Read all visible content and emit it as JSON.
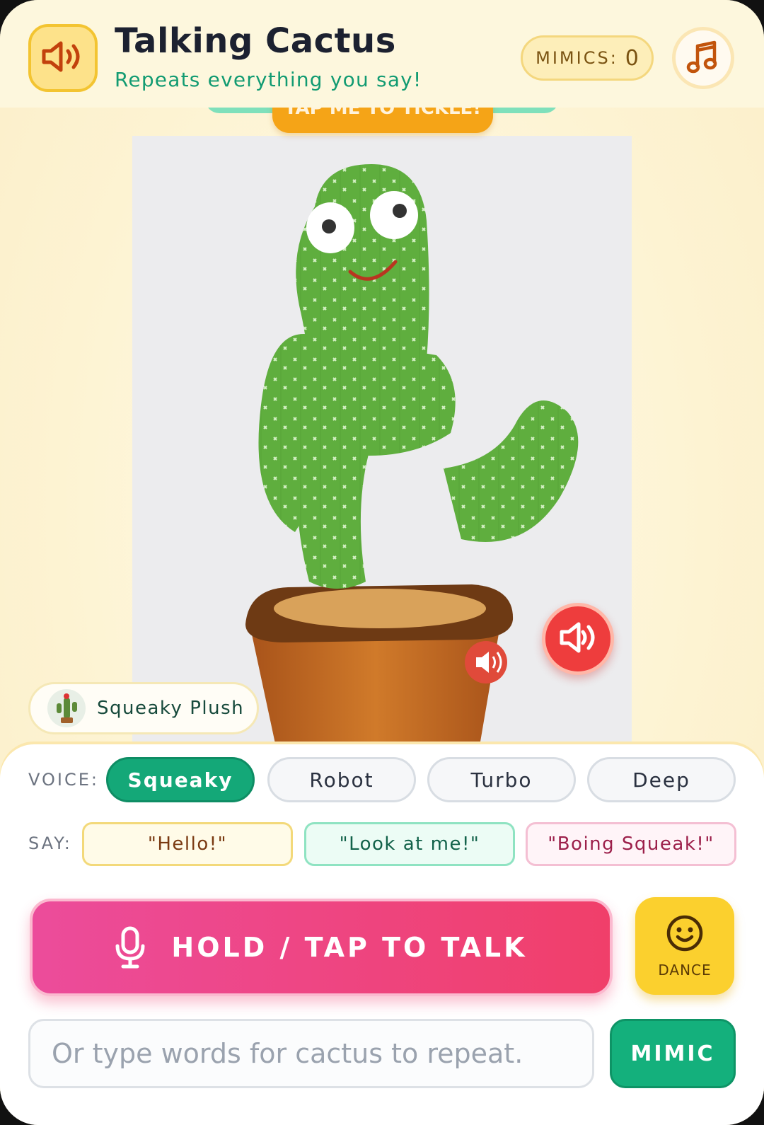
{
  "header": {
    "title": "Talking Cactus",
    "subtitle": "Repeats everything you say!",
    "mimics_label": "MIMICS:",
    "mimics_count": "0"
  },
  "tickle_banner": "TAP ME TO TICKLE!",
  "plush_badge": {
    "label": "Squeaky Plush"
  },
  "voice": {
    "label": "VOICE:",
    "options": [
      "Squeaky",
      "Robot",
      "Turbo",
      "Deep"
    ],
    "selected": "Squeaky"
  },
  "say": {
    "label": "SAY:",
    "phrases": [
      "\"Hello!\"",
      "\"Look at me!\"",
      "\"Boing Squeak!\""
    ]
  },
  "talk_button": "HOLD / TAP TO TALK",
  "dance_button": "DANCE",
  "input": {
    "placeholder": "Or type words for cactus to repeat.",
    "value": ""
  },
  "mimic_button": "MIMIC",
  "colors": {
    "accent_green": "#14a878",
    "talk_pink": "#ec4c9b",
    "dance_yellow": "#fbd02e",
    "sound_red": "#ee3d3d"
  }
}
